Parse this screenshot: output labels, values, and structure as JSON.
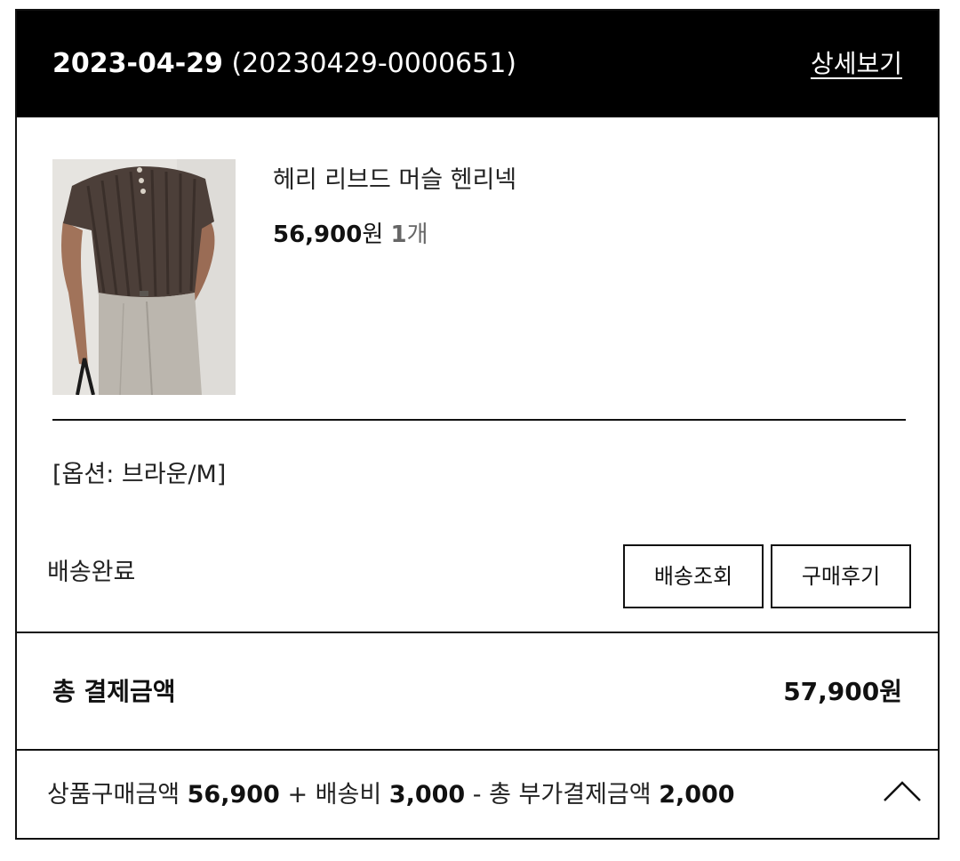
{
  "order": {
    "date": "2023-04-29",
    "order_number": "(20230429-0000651)",
    "detail_link_label": "상세보기"
  },
  "product": {
    "name": "헤리 리브드 머슬 헨리넥",
    "price_amount": "56,900",
    "price_unit": "원",
    "quantity": "1",
    "quantity_unit": "개",
    "option": "[옵션: 브라운/M]",
    "image_icon": "product-photo"
  },
  "delivery": {
    "status": "배송완료",
    "track_button_label": "배송조회",
    "review_button_label": "구매후기"
  },
  "payment": {
    "total_label": "총 결제금액",
    "total_value": "57,900원",
    "breakdown": {
      "product_label": "상품구매금액",
      "product_amount": "56,900",
      "plus_sign": "+",
      "shipping_label": "배송비",
      "shipping_amount": "3,000",
      "minus_sign": "-",
      "discount_label": "총 부가결제금액",
      "discount_amount": "2,000"
    },
    "toggle_icon": "chevron-up"
  },
  "colors": {
    "header_bg": "#000000",
    "header_text": "#ffffff",
    "border": "#111111",
    "quantity_text": "#666666"
  }
}
